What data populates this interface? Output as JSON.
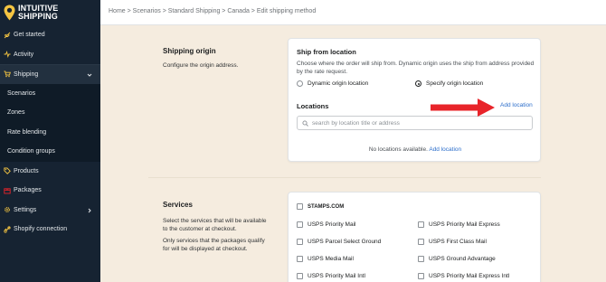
{
  "brand": {
    "name_line1": "INTUITIVE",
    "name_line2": "SHIPPING",
    "pin_color": "#f5c542"
  },
  "sidebar": {
    "items": [
      {
        "label": "Get started",
        "icon": "rocket-icon"
      },
      {
        "label": "Activity",
        "icon": "activity-icon"
      },
      {
        "label": "Shipping",
        "icon": "shipping-cart-icon",
        "expanded": true
      },
      {
        "label": "Scenarios"
      },
      {
        "label": "Zones"
      },
      {
        "label": "Rate blending"
      },
      {
        "label": "Condition groups"
      },
      {
        "label": "Products",
        "icon": "tag-icon"
      },
      {
        "label": "Packages",
        "icon": "package-icon"
      },
      {
        "label": "Settings",
        "icon": "gear-icon"
      },
      {
        "label": "Shopify connection",
        "icon": "connection-icon"
      }
    ]
  },
  "breadcrumb": "Home > Scenarios > Standard Shipping > Canada > Edit shipping method",
  "shipping_origin": {
    "title": "Shipping origin",
    "description": "Configure the origin address."
  },
  "ship_from": {
    "title": "Ship from location",
    "description_line1": "Choose where the order will ship from. Dynamic origin uses the ship from address provided",
    "description_line2": "by the rate request.",
    "option_dynamic": "Dynamic origin location",
    "option_specify": "Specify origin location",
    "selected": "specify",
    "locations_title": "Locations",
    "add_location": "Add location",
    "search_placeholder": "search by location title or address",
    "empty_text": "No locations available.",
    "empty_link": "Add location"
  },
  "services": {
    "title": "Services",
    "desc1_line1": "Select the services that will be available",
    "desc1_line2": "to the customer at checkout.",
    "desc2_line1": "Only services that the packages qualify",
    "desc2_line2": "for will be displayed at checkout.",
    "carrier": "STAMPS.COM",
    "left": [
      "USPS Priority Mail",
      "USPS Parcel Select Ground",
      "USPS Media Mail",
      "USPS Priority Mail Intl"
    ],
    "right": [
      "USPS Priority Mail Express",
      "USPS First Class Mail",
      "USPS Ground Advantage",
      "USPS Priority Mail Express Intl"
    ]
  },
  "annotation_arrow_color": "#e8242a"
}
